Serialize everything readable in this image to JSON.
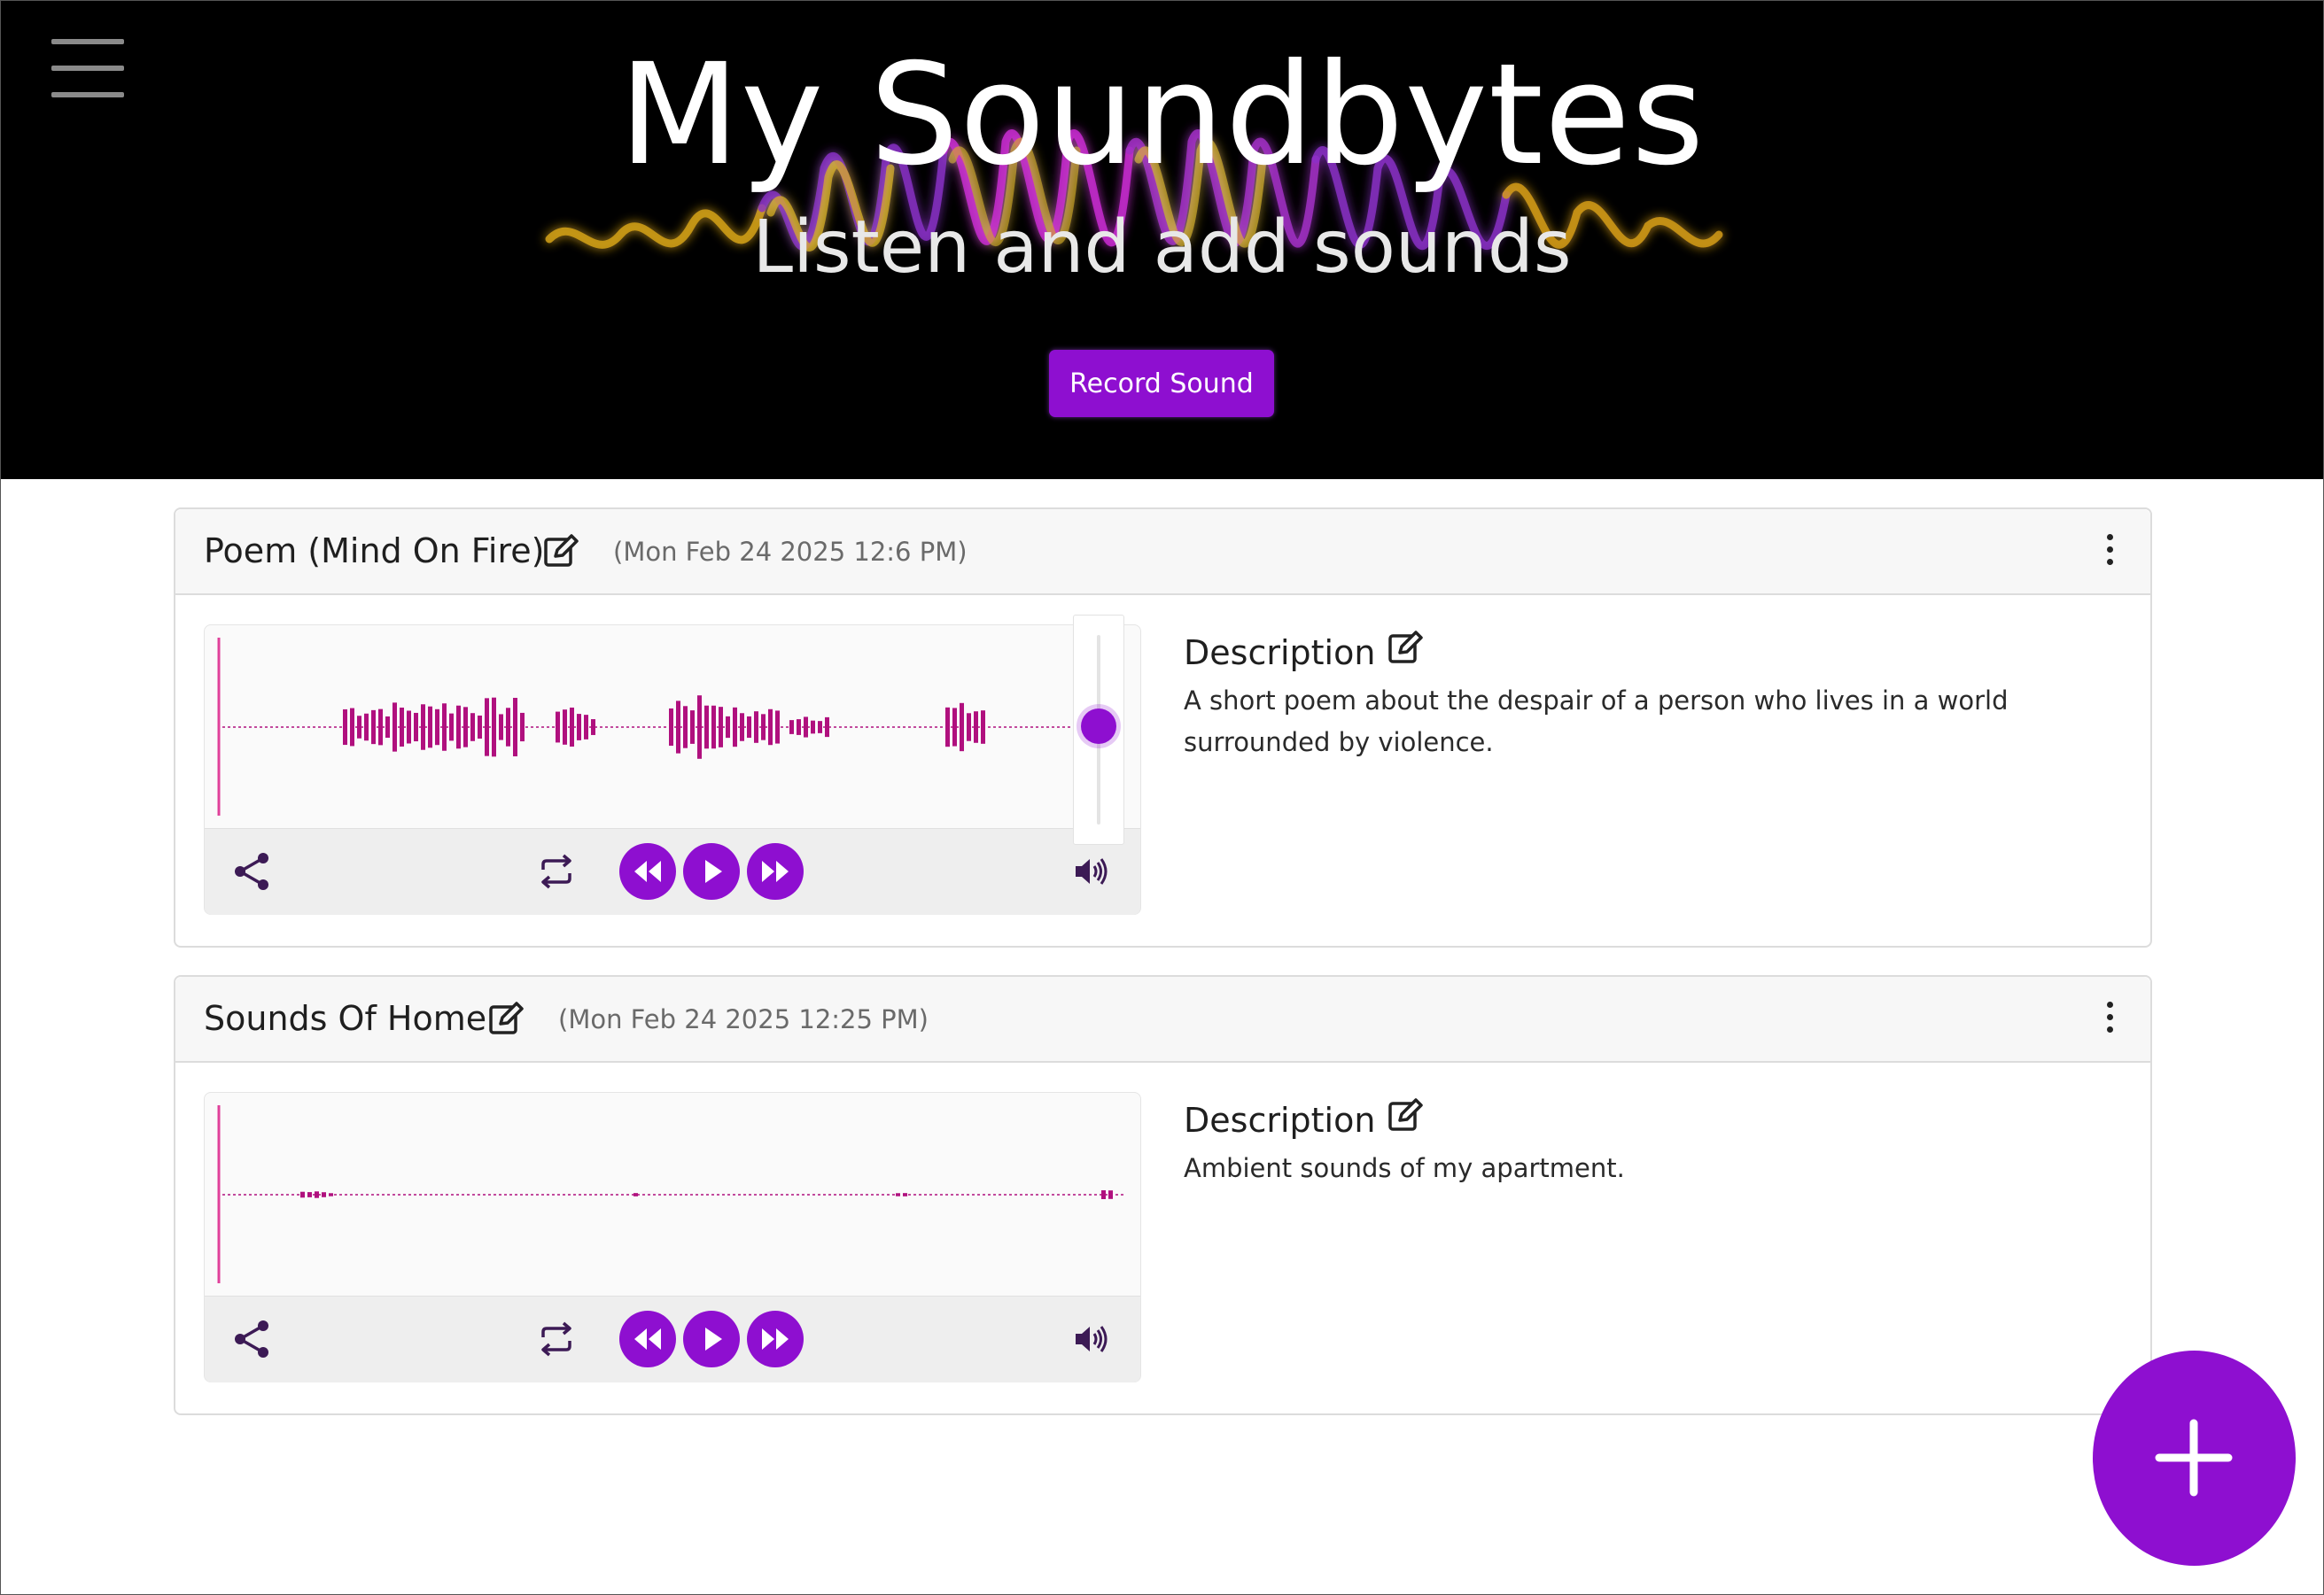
{
  "header": {
    "title": "My Soundbytes",
    "subtitle": "Listen and add sounds",
    "record_label": "Record Sound"
  },
  "sounds": [
    {
      "title": "Poem (Mind On Fire)",
      "date": "(Mon Feb 24 2025 12:6 PM)",
      "description_heading": "Description",
      "description": "A short poem about the despair of a person who lives in a world surrounded by violence.",
      "volume_level": 0.52
    },
    {
      "title": "Sounds Of Home",
      "date": "(Mon Feb 24 2025 12:25 PM)",
      "description_heading": "Description",
      "description": "Ambient sounds of my apartment."
    }
  ],
  "icons": [
    "menu-icon",
    "edit-icon",
    "more-icon",
    "share-icon",
    "repeat-icon",
    "rewind-icon",
    "play-icon",
    "fast-forward-icon",
    "volume-icon",
    "plus-icon"
  ],
  "colors": {
    "accent": "#8e0fd0",
    "waveform": "#b0107e",
    "hero_background": "#000000"
  }
}
